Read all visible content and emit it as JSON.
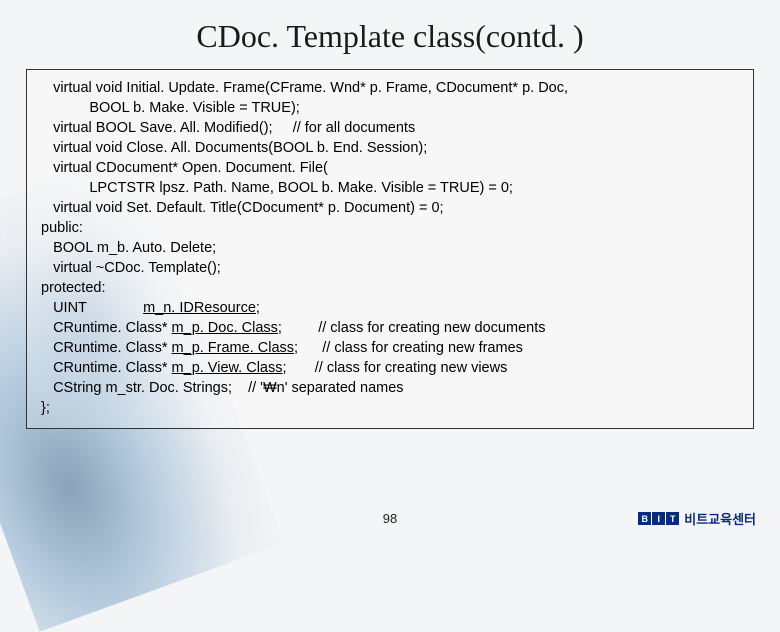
{
  "title": "CDoc. Template class(contd. )",
  "code": {
    "line1a": "   virtual void Initial. Update. Frame(CFrame. Wnd* p. Frame, CDocument* p. Doc,",
    "line1b": "            BOOL b. Make. Visible = TRUE);",
    "line2": "   virtual BOOL Save. All. Modified();     // for all documents",
    "line3": "   virtual void Close. All. Documents(BOOL b. End. Session);",
    "line4a": "   virtual CDocument* Open. Document. File(",
    "line4b": "            LPCTSTR lpsz. Path. Name, BOOL b. Make. Visible = TRUE) = 0;",
    "line5": "   virtual void Set. Default. Title(CDocument* p. Document) = 0;",
    "line6": "public:",
    "line7": "   BOOL m_b. Auto. Delete;",
    "line8": "   virtual ~CDoc. Template();",
    "line9": "protected:",
    "line10p": "   UINT              ",
    "line10u": "m_n. IDResource",
    "line10s": ";",
    "line11p": "   CRuntime. Class* ",
    "line11u": "m_p. Doc. Class",
    "line11s": ";         // class for creating new documents",
    "line12p": "   CRuntime. Class* ",
    "line12u": "m_p. Frame. Class",
    "line12s": ";      // class for creating new frames",
    "line13p": "   CRuntime. Class* ",
    "line13u": "m_p. View. Class",
    "line13s": ";       // class for creating new views",
    "line14": "   CString m_str. Doc. Strings;    // '₩n' separated names",
    "line15": "};"
  },
  "page_number": "98",
  "logo": {
    "b": "B",
    "i": "I",
    "t": "T",
    "text": "비트교육센터"
  }
}
